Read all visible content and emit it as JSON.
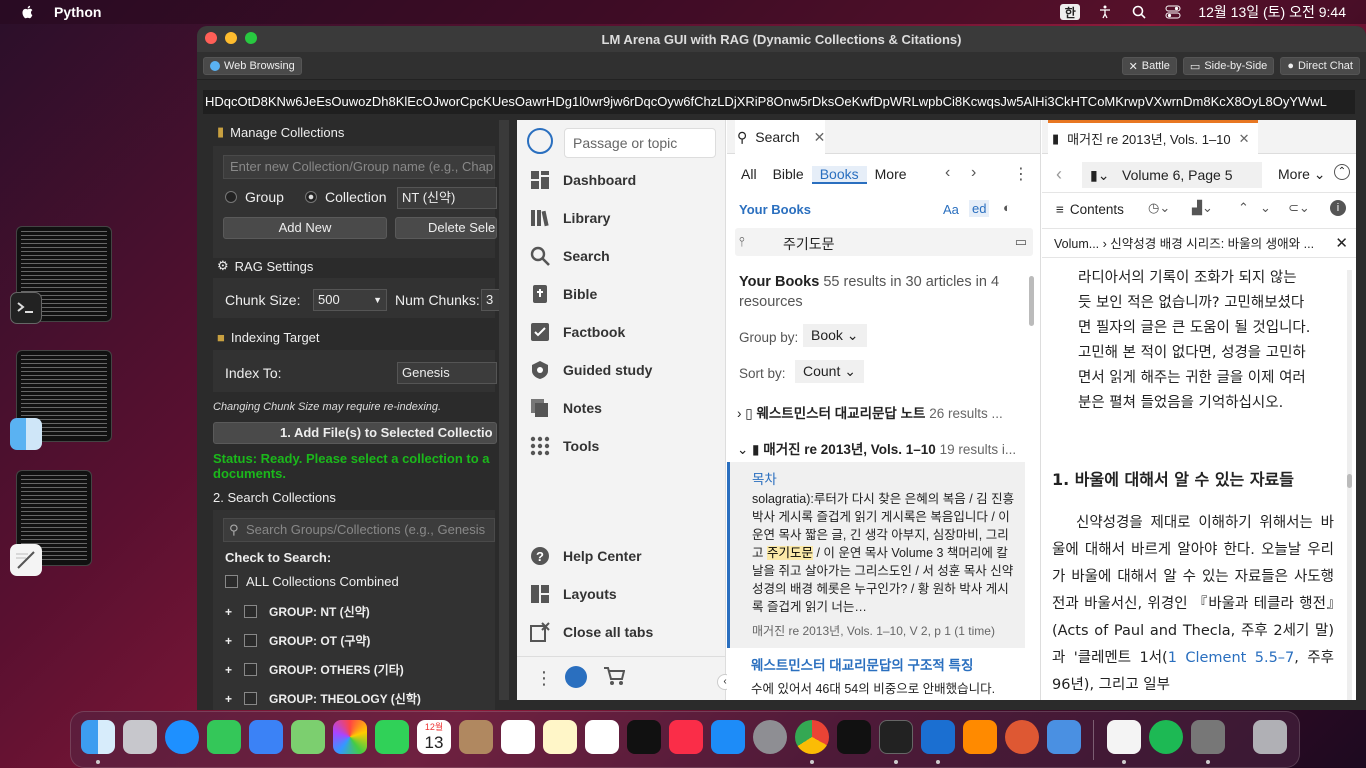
{
  "menubar": {
    "app": "Python",
    "clock": "12월 13일 (토) 오전 9:44",
    "han": "한"
  },
  "window": {
    "title": "LM Arena GUI with RAG (Dynamic Collections & Citations)",
    "tab_web": "Web Browsing",
    "battle": "Battle",
    "side_by_side": "Side-by-Side",
    "direct_chat": "Direct Chat",
    "url": "HDqcOtD8KNw6JeEsOuwozDh8KlEcOJworCpcKUesOawrHDg1l0wr9jw6rDqcOyw6fChzLDjXRiP8Onw5rDksOeKwfDpWRLwpbCi8KcwqsJw5AlHi3CkHTCoMKrwpVXwrnDm8KcX8OyL8OyYWwL"
  },
  "left": {
    "manage_title": "Manage Collections",
    "collection_placeholder": "Enter new Collection/Group name (e.g., Chap",
    "group_label": "Group",
    "collection_label": "Collection",
    "collection_select": "NT (신약)",
    "add_new": "Add New",
    "delete_sel": "Delete Sele",
    "rag_title": "RAG Settings",
    "chunk_size_label": "Chunk Size:",
    "chunk_size_value": "500",
    "num_chunks_label": "Num Chunks:",
    "num_chunks_value": "3",
    "index_title": "Indexing Target",
    "index_to_label": "Index To:",
    "index_to_value": "Genesis",
    "note": "Changing Chunk Size may require re-indexing.",
    "add_files": "1. Add File(s) to Selected Collectio",
    "status": "Status: Ready. Please select a collection to a documents.",
    "search_title": "2. Search Collections",
    "search_placeholder": "Search Groups/Collections (e.g., Genesis",
    "check_label": "Check to Search:",
    "all_combined": "ALL Collections Combined",
    "groups": [
      {
        "label": "GROUP: NT (신약)"
      },
      {
        "label": "GROUP: OT (구약)"
      },
      {
        "label": "GROUP: OTHERS (기타)"
      },
      {
        "label": "GROUP: THEOLOGY (신학)"
      }
    ]
  },
  "logos_nav": {
    "search_placeholder": "Passage or topic",
    "items": [
      {
        "label": "Dashboard"
      },
      {
        "label": "Library"
      },
      {
        "label": "Search"
      },
      {
        "label": "Bible"
      },
      {
        "label": "Factbook"
      },
      {
        "label": "Guided study"
      },
      {
        "label": "Notes"
      },
      {
        "label": "Tools"
      }
    ],
    "bottom": [
      {
        "label": "Help Center"
      },
      {
        "label": "Layouts"
      },
      {
        "label": "Close all tabs"
      }
    ]
  },
  "search_panel": {
    "tab": "Search",
    "filters": [
      "All",
      "Bible",
      "Books",
      "More"
    ],
    "your_books": "Your Books",
    "aa": "Aa",
    "ed": "ed",
    "query": "주기도문",
    "results_title": "Your Books",
    "results_count": "55 results in 30 articles in 4 resources",
    "group_by_label": "Group by:",
    "group_by_value": "Book",
    "sort_by_label": "Sort by:",
    "sort_by_value": "Count",
    "books": [
      {
        "title": "웨스트민스터 대교리문답 노트",
        "count": "26 results ..."
      },
      {
        "title": "매거진 re 2013년, Vols. 1–10",
        "count": "19 results i..."
      }
    ],
    "hit_title": "목차",
    "hit_pre": "solagratia):루터가 다시 찾은 은혜의 복음 / 김 진흥 박사 게시록 즐겁게 읽기 게시록은 복음입니다 / 이 운연 목사 짧은 글, 긴 생각 아부지, 심장마비, 그리고 ",
    "hit_mark": "주기도문",
    "hit_post": " / 이 운연 목사 Volume 3 책머리에 칼날을 쥐고 살아가는 그리스도인 / 서 성훈 목사 신약성경의 배경 헤롯은 누구인가? / 황 원하 박사 게시록 즐겁게 읽기 너는…",
    "hit_source": "매거진 re 2013년, Vols. 1–10, V 2, p 1 (1 time)",
    "next_title": "웨스트민스터 대교리문답의 구조적 특징",
    "next_text": "수에 있어서 46대 54의 비중으로 안배했습니다."
  },
  "reader": {
    "tab": "매거진 re 2013년, Vols. 1–10",
    "location": "Volume 6, Page 5",
    "more": "More",
    "contents": "Contents",
    "breadcrumb_a": "Volum...",
    "breadcrumb_b": "신약성경 배경 시리즈: 바울의 생애와 ...",
    "top_text": "라디아서의 기록이 조화가 되지 않는 듯 보인 적은 없습니까? 고민해보셨다면 필자의 글은 큰 도움이 될 것입니다. 고민해 본 적이 없다면, 성경을 고민하면서 읽게 해주는 귀한 글을 이제 여러분은 펼쳐 들었음을 기억하십시오.",
    "heading": "1. 바울에 대해서 알 수 있는 자료들",
    "body_a": "신약성경을 제대로 이해하기 위해서는 바울에 대해서 바르게 알아야 한다. 오늘날 우리가 바울에 대해서 알 수 있는 자료들은 사도행전과 바울서신, 위경인 『바울과 테클라 행전』(Acts of Paul and Thecla, 주후 2세기 말)과 '클레멘트 1서(",
    "body_link": "1 Clement 5.5–7",
    "body_b": ", 주후 96년), 그리고 일부"
  },
  "dock": {
    "calendar_month": "12월",
    "calendar_day": "13"
  }
}
